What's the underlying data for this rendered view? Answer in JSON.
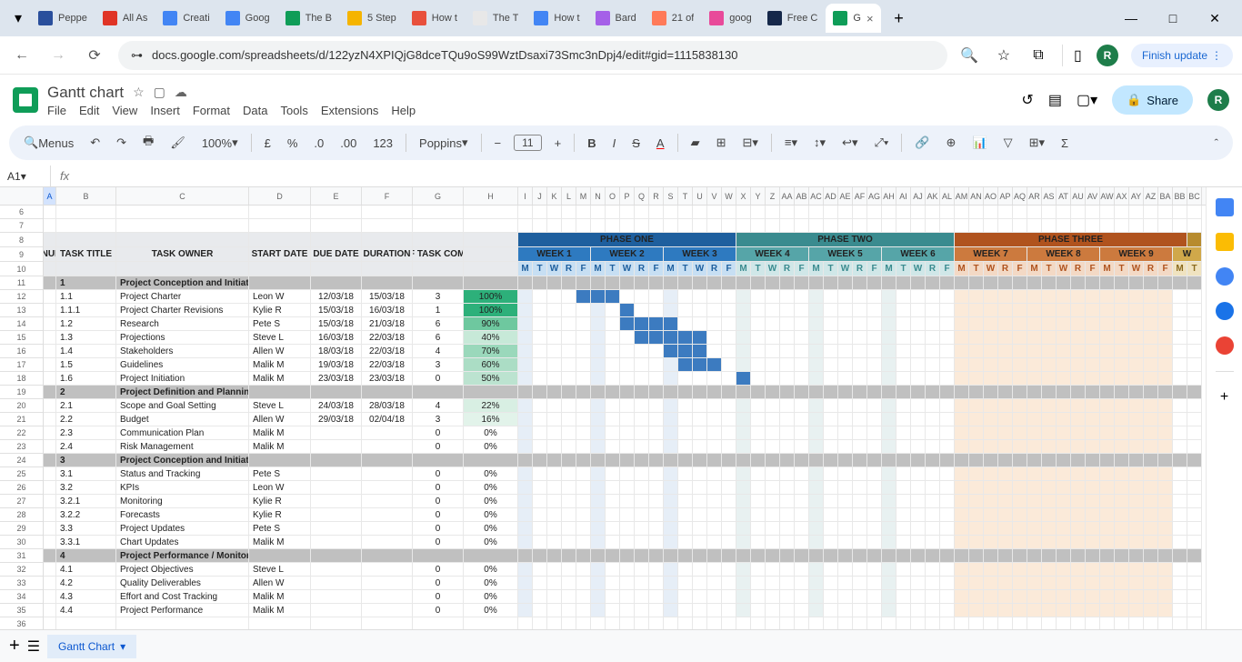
{
  "chrome": {
    "tabs": [
      {
        "title": "Peppe",
        "favicon": "#2a4f9c"
      },
      {
        "title": "All As",
        "favicon": "#e03426"
      },
      {
        "title": "Creati",
        "favicon": "#4285f4"
      },
      {
        "title": "Goog",
        "favicon": "#4285f4"
      },
      {
        "title": "The B",
        "favicon": "#0f9d58"
      },
      {
        "title": "5 Step",
        "favicon": "#f5b400"
      },
      {
        "title": "How t",
        "favicon": "#e8503c"
      },
      {
        "title": "The T",
        "favicon": "#e8e8e8"
      },
      {
        "title": "How t",
        "favicon": "#4285f4"
      },
      {
        "title": "Bard",
        "favicon": "#a560e8"
      },
      {
        "title": "21 of",
        "favicon": "#ff7a59"
      },
      {
        "title": "goog",
        "favicon": "#e84a9a"
      },
      {
        "title": "Free C",
        "favicon": "#16284a"
      },
      {
        "title": "G",
        "favicon": "#0f9d58",
        "active": true
      }
    ],
    "url": "docs.google.com/spreadsheets/d/122yzN4XPIQjG8dceTQu9oS99WztDsaxi73Smc3nDpj4/edit#gid=1115838130",
    "finish_update": "Finish update",
    "profile_letter": "R"
  },
  "doc": {
    "title": "Gantt chart",
    "menus": [
      "File",
      "Edit",
      "View",
      "Insert",
      "Format",
      "Data",
      "Tools",
      "Extensions",
      "Help"
    ],
    "share": "Share"
  },
  "toolbar": {
    "menus_label": "Menus",
    "zoom": "100%",
    "font": "Poppins",
    "font_size": "11"
  },
  "cell_ref": "A1",
  "sheet_tab": "Gantt Chart",
  "columns": [
    "A",
    "B",
    "C",
    "D",
    "E",
    "F",
    "G",
    "H"
  ],
  "small_cols": [
    "I",
    "J",
    "K",
    "L",
    "M",
    "N",
    "O",
    "P",
    "Q",
    "R",
    "S",
    "T",
    "U",
    "V",
    "W",
    "X",
    "Y",
    "Z",
    "AA",
    "AB",
    "AC",
    "AD",
    "AE",
    "AF",
    "AG",
    "AH",
    "AI",
    "AJ",
    "AK",
    "AL",
    "AM",
    "AN",
    "AO",
    "AP",
    "AQ",
    "AR",
    "AS",
    "AT",
    "AU",
    "AV",
    "AW",
    "AX",
    "AY",
    "AZ",
    "BA",
    "BB",
    "BC"
  ],
  "row_nums": [
    6,
    7,
    8,
    9,
    10,
    11,
    12,
    13,
    14,
    15,
    16,
    17,
    18,
    19,
    20,
    21,
    22,
    23,
    24,
    25,
    26,
    27,
    28,
    29,
    30,
    31,
    32,
    33,
    34,
    35,
    36
  ],
  "phases": [
    {
      "label": "PHASE ONE",
      "color": "#1e5f9e",
      "span": 15
    },
    {
      "label": "PHASE TWO",
      "color": "#3a8b8f",
      "span": 15
    },
    {
      "label": "PHASE THREE",
      "color": "#b0531e",
      "span": 16
    },
    {
      "label": "",
      "color": "#b78b2e",
      "span": 1
    }
  ],
  "weeks": [
    {
      "label": "WEEK 1",
      "color": "#2e7ac0"
    },
    {
      "label": "WEEK 2",
      "color": "#2e7ac0"
    },
    {
      "label": "WEEK 3",
      "color": "#2e7ac0"
    },
    {
      "label": "WEEK 4",
      "color": "#56a5a8"
    },
    {
      "label": "WEEK 5",
      "color": "#56a5a8"
    },
    {
      "label": "WEEK 6",
      "color": "#56a5a8"
    },
    {
      "label": "WEEK 7",
      "color": "#cc7a3e"
    },
    {
      "label": "WEEK 8",
      "color": "#cc7a3e"
    },
    {
      "label": "WEEK 9",
      "color": "#cc7a3e"
    },
    {
      "label": "W",
      "color": "#d0a84a"
    }
  ],
  "days": [
    "M",
    "T",
    "W",
    "R",
    "F"
  ],
  "data_headers": [
    "WBS NUMBER",
    "TASK TITLE",
    "TASK OWNER",
    "START DATE",
    "DUE DATE",
    "DURATION",
    "PCT OF TASK COMPLETE"
  ],
  "rows": [
    {
      "type": "section",
      "wbs": "1",
      "title": "Project Conception and Initiation"
    },
    {
      "wbs": "1.1",
      "title": "Project Charter",
      "owner": "Leon W",
      "start": "12/03/18",
      "due": "15/03/18",
      "dur": "3",
      "pct": "100%",
      "pctbg": "#2db07a",
      "bar": [
        4,
        3
      ]
    },
    {
      "wbs": "1.1.1",
      "title": "Project Charter Revisions",
      "owner": "Kylie R",
      "start": "15/03/18",
      "due": "16/03/18",
      "dur": "1",
      "pct": "100%",
      "pctbg": "#2db07a",
      "bar": [
        7,
        1
      ]
    },
    {
      "wbs": "1.2",
      "title": "Research",
      "owner": "Pete S",
      "start": "15/03/18",
      "due": "21/03/18",
      "dur": "6",
      "pct": "90%",
      "pctbg": "#6ec89f",
      "bar": [
        7,
        4
      ]
    },
    {
      "wbs": "1.3",
      "title": "Projections",
      "owner": "Steve L",
      "start": "16/03/18",
      "due": "22/03/18",
      "dur": "6",
      "pct": "40%",
      "pctbg": "#c7e9d8",
      "bar": [
        8,
        5
      ]
    },
    {
      "wbs": "1.4",
      "title": "Stakeholders",
      "owner": "Allen W",
      "start": "18/03/18",
      "due": "22/03/18",
      "dur": "4",
      "pct": "70%",
      "pctbg": "#9ad8bb",
      "bar": [
        10,
        3
      ]
    },
    {
      "wbs": "1.5",
      "title": "Guidelines",
      "owner": "Malik M",
      "start": "19/03/18",
      "due": "22/03/18",
      "dur": "3",
      "pct": "60%",
      "pctbg": "#abddc5",
      "bar": [
        11,
        3
      ]
    },
    {
      "wbs": "1.6",
      "title": "Project Initiation",
      "owner": "Malik M",
      "start": "23/03/18",
      "due": "23/03/18",
      "dur": "0",
      "pct": "50%",
      "pctbg": "#bce3d0",
      "bar": [
        15,
        1
      ]
    },
    {
      "type": "section",
      "wbs": "2",
      "title": "Project Definition and Planning"
    },
    {
      "wbs": "2.1",
      "title": "Scope and Goal Setting",
      "owner": "Steve L",
      "start": "24/03/18",
      "due": "28/03/18",
      "dur": "4",
      "pct": "22%",
      "pctbg": "#d8efe3"
    },
    {
      "wbs": "2.2",
      "title": "Budget",
      "owner": "Allen W",
      "start": "29/03/18",
      "due": "02/04/18",
      "dur": "3",
      "pct": "16%",
      "pctbg": "#e2f3ea"
    },
    {
      "wbs": "2.3",
      "title": "Communication Plan",
      "owner": "Malik M",
      "start": "",
      "due": "",
      "dur": "0",
      "pct": "0%",
      "pctbg": "#ffffff"
    },
    {
      "wbs": "2.4",
      "title": "Risk Management",
      "owner": "Malik M",
      "start": "",
      "due": "",
      "dur": "0",
      "pct": "0%",
      "pctbg": "#ffffff"
    },
    {
      "type": "section",
      "wbs": "3",
      "title": "Project Conception and Initiation"
    },
    {
      "wbs": "3.1",
      "title": "Status and Tracking",
      "owner": "Pete S",
      "start": "",
      "due": "",
      "dur": "0",
      "pct": "0%",
      "pctbg": "#ffffff"
    },
    {
      "wbs": "3.2",
      "title": "KPIs",
      "owner": "Leon W",
      "start": "",
      "due": "",
      "dur": "0",
      "pct": "0%",
      "pctbg": "#ffffff"
    },
    {
      "wbs": "3.2.1",
      "title": "Monitoring",
      "owner": "Kylie R",
      "start": "",
      "due": "",
      "dur": "0",
      "pct": "0%",
      "pctbg": "#ffffff"
    },
    {
      "wbs": "3.2.2",
      "title": "Forecasts",
      "owner": "Kylie R",
      "start": "",
      "due": "",
      "dur": "0",
      "pct": "0%",
      "pctbg": "#ffffff"
    },
    {
      "wbs": "3.3",
      "title": "Project Updates",
      "owner": "Pete S",
      "start": "",
      "due": "",
      "dur": "0",
      "pct": "0%",
      "pctbg": "#ffffff"
    },
    {
      "wbs": "3.3.1",
      "title": "Chart Updates",
      "owner": "Malik M",
      "start": "",
      "due": "",
      "dur": "0",
      "pct": "0%",
      "pctbg": "#ffffff"
    },
    {
      "type": "section",
      "wbs": "4",
      "title": "Project Performance / Monitoring"
    },
    {
      "wbs": "4.1",
      "title": "Project Objectives",
      "owner": "Steve L",
      "start": "",
      "due": "",
      "dur": "0",
      "pct": "0%",
      "pctbg": "#ffffff"
    },
    {
      "wbs": "4.2",
      "title": "Quality Deliverables",
      "owner": "Allen W",
      "start": "",
      "due": "",
      "dur": "0",
      "pct": "0%",
      "pctbg": "#ffffff"
    },
    {
      "wbs": "4.3",
      "title": "Effort and Cost Tracking",
      "owner": "Malik M",
      "start": "",
      "due": "",
      "dur": "0",
      "pct": "0%",
      "pctbg": "#ffffff"
    },
    {
      "wbs": "4.4",
      "title": "Project Performance",
      "owner": "Malik M",
      "start": "",
      "due": "",
      "dur": "0",
      "pct": "0%",
      "pctbg": "#ffffff"
    }
  ]
}
